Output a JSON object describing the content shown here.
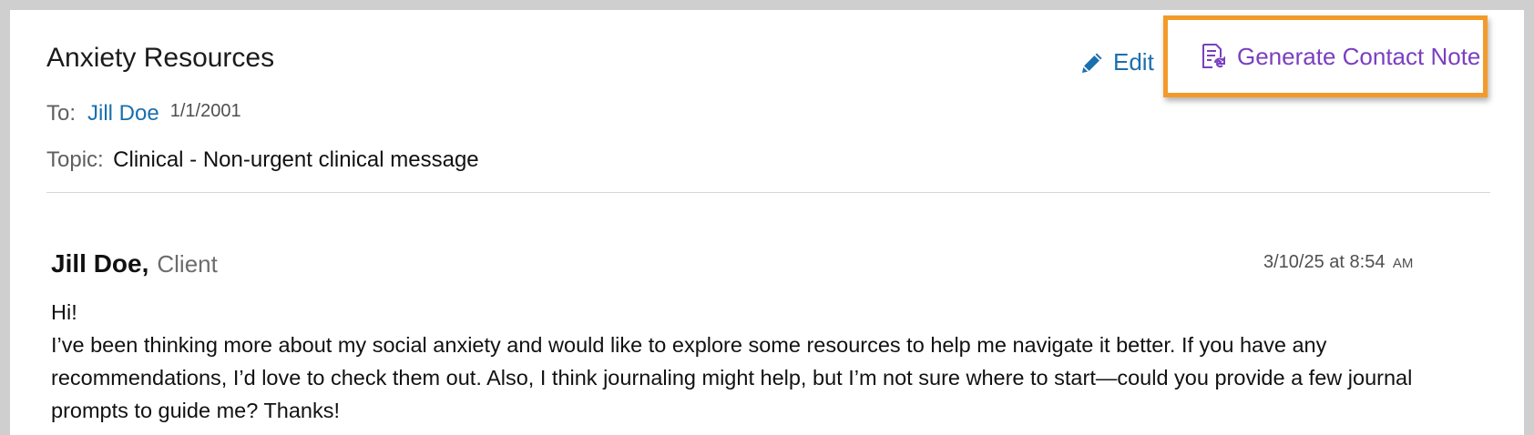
{
  "message": {
    "subject": "Anxiety Resources",
    "to_label": "To:",
    "to_name": "Jill Doe",
    "to_dob": "1/1/2001",
    "topic_label": "Topic:",
    "topic_value": "Clinical - Non-urgent clinical message"
  },
  "actions": {
    "edit_label": "Edit",
    "edit_icon": "pencil-icon",
    "generate_label": "Generate Contact Note",
    "generate_icon": "contact-note-icon",
    "highlight_color": "#f39a29"
  },
  "thread": {
    "sender_name": "Jill Doe,",
    "sender_role": "Client",
    "timestamp": "3/10/25 at 8:54",
    "timestamp_ampm": "AM",
    "greeting": "Hi!",
    "body": "I’ve been thinking more about my social anxiety and would like to explore some resources to help me navigate it better. If you have any recommendations, I’d love to check them out. Also, I think journaling might help, but I’m not sure where to start—could you provide a few journal prompts to guide me? Thanks!"
  },
  "colors": {
    "link_blue": "#1a6fae",
    "accent_purple": "#7a3fc0"
  }
}
